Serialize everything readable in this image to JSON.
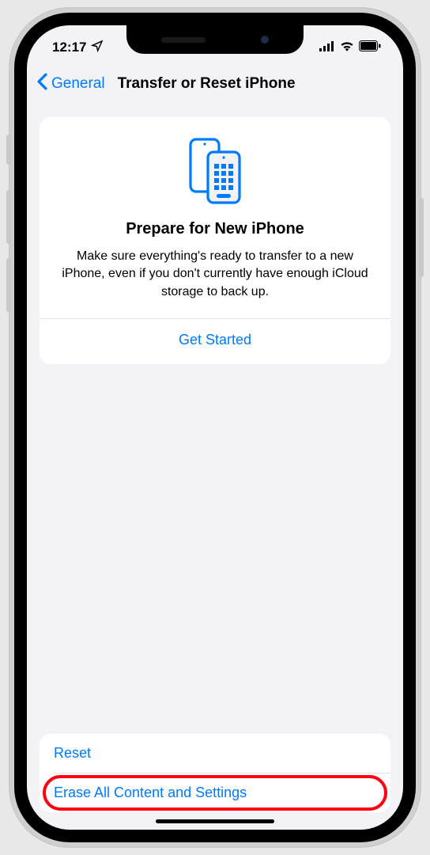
{
  "status": {
    "time": "12:17"
  },
  "nav": {
    "back_label": "General",
    "title": "Transfer or Reset iPhone"
  },
  "prepare": {
    "title": "Prepare for New iPhone",
    "body": "Make sure everything's ready to transfer to a new iPhone, even if you don't currently have enough iCloud storage to back up.",
    "action": "Get Started"
  },
  "bottom": {
    "reset": "Reset",
    "erase": "Erase All Content and Settings"
  },
  "colors": {
    "accent": "#007aff",
    "highlight": "#ff0014"
  }
}
